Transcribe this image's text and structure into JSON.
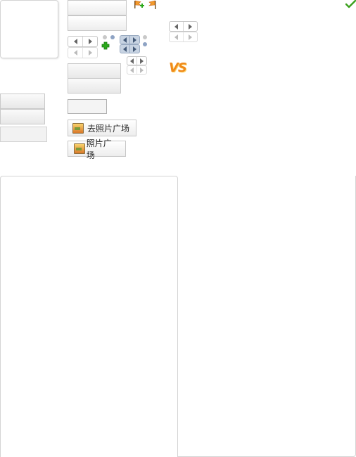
{
  "buttons": {
    "go_photo_plaza": "去照片广场",
    "photo_plaza": "照片广场"
  },
  "badges": {
    "versus": "VS"
  },
  "icons": {
    "flag_add": "flag-add-icon",
    "flag": "flag-icon",
    "check": "check-icon",
    "plus": "plus-icon",
    "photo": "photo-icon"
  },
  "colors": {
    "check": "#3aa01c",
    "plus": "#2aa81a",
    "vs": "#f08a1a",
    "dot_gray": "#c8c8c8",
    "dot_blue": "#8ea3c4",
    "pager_active": "#c7d3e2"
  }
}
